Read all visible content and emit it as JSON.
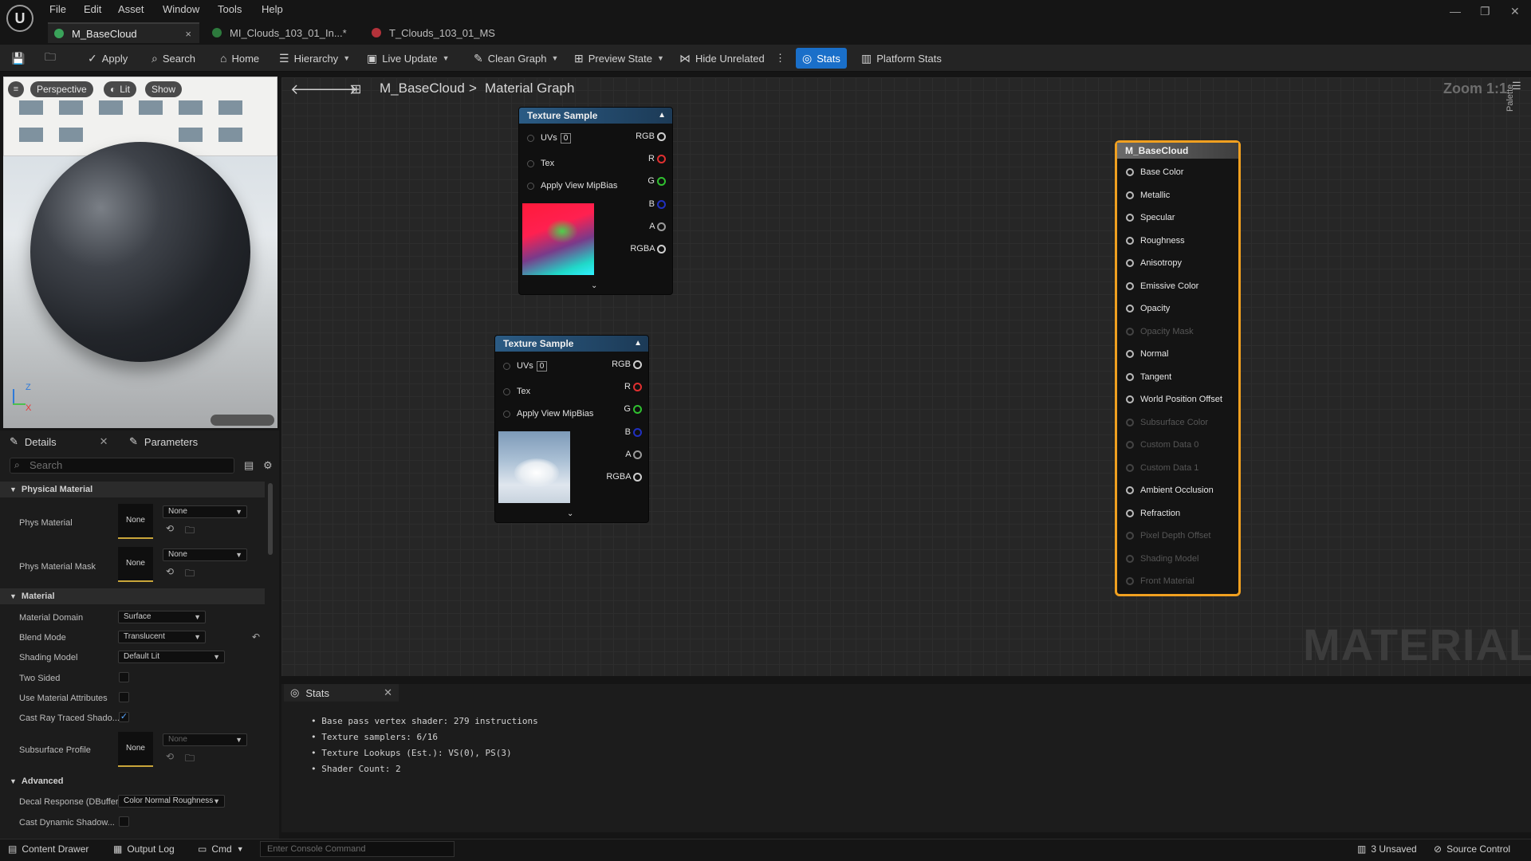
{
  "menu": [
    "File",
    "Edit",
    "Asset",
    "Window",
    "Tools",
    "Help"
  ],
  "tabs": [
    {
      "label": "M_BaseCloud",
      "close": "×"
    },
    {
      "label": "MI_Clouds_103_01_In...*"
    },
    {
      "label": "T_Clouds_103_01_MS"
    }
  ],
  "toolbar": {
    "apply": "Apply",
    "search": "Search",
    "home": "Home",
    "hierarchy": "Hierarchy",
    "live_update": "Live Update",
    "clean_graph": "Clean Graph",
    "preview_state": "Preview State",
    "hide_unrelated": "Hide Unrelated",
    "stats": "Stats",
    "platform_stats": "Platform Stats"
  },
  "viewport": {
    "perspective": "Perspective",
    "lit": "Lit",
    "show": "Show",
    "axis_z": "Z",
    "axis_x": "X"
  },
  "panel": {
    "details": "Details",
    "parameters": "Parameters",
    "search_placeholder": "Search"
  },
  "physical_material": {
    "section": "Physical Material",
    "phys_material": "Phys Material",
    "phys_material_mask": "Phys Material Mask",
    "none": "None"
  },
  "material": {
    "section": "Material",
    "domain_label": "Material Domain",
    "domain_value": "Surface",
    "blend_label": "Blend Mode",
    "blend_value": "Translucent",
    "shading_label": "Shading Model",
    "shading_value": "Default Lit",
    "two_sided": "Two Sided",
    "use_attrs": "Use Material Attributes",
    "cast_ray": "Cast Ray Traced Shado...",
    "subsurface": "Subsurface Profile"
  },
  "advanced": {
    "section": "Advanced",
    "decal_label": "Decal Response (DBuffer)",
    "decal_value": "Color Normal Roughness",
    "cast_dynamic": "Cast Dynamic Shadow..."
  },
  "graph": {
    "asset": "M_BaseCloud",
    "sep": ">",
    "title": "Material Graph",
    "zoom": "Zoom 1:1",
    "watermark": "MATERIAL",
    "palette": "Palette"
  },
  "texture_nodes": [
    {
      "title": "Texture Sample",
      "uvs": "UVs",
      "uv_index": "0",
      "tex": "Tex",
      "mip": "Apply View MipBias",
      "outputs": [
        "RGB",
        "R",
        "G",
        "B",
        "A",
        "RGBA"
      ]
    },
    {
      "title": "Texture Sample",
      "uvs": "UVs",
      "uv_index": "0",
      "tex": "Tex",
      "mip": "Apply View MipBias",
      "outputs": [
        "RGB",
        "R",
        "G",
        "B",
        "A",
        "RGBA"
      ]
    }
  ],
  "material_node": {
    "title": "M_BaseCloud",
    "inputs": [
      {
        "label": "Base Color",
        "enabled": true
      },
      {
        "label": "Metallic",
        "enabled": true
      },
      {
        "label": "Specular",
        "enabled": true
      },
      {
        "label": "Roughness",
        "enabled": true
      },
      {
        "label": "Anisotropy",
        "enabled": true
      },
      {
        "label": "Emissive Color",
        "enabled": true
      },
      {
        "label": "Opacity",
        "enabled": true
      },
      {
        "label": "Opacity Mask",
        "enabled": false
      },
      {
        "label": "Normal",
        "enabled": true
      },
      {
        "label": "Tangent",
        "enabled": true
      },
      {
        "label": "World Position Offset",
        "enabled": true
      },
      {
        "label": "Subsurface Color",
        "enabled": false
      },
      {
        "label": "Custom Data 0",
        "enabled": false
      },
      {
        "label": "Custom Data 1",
        "enabled": false
      },
      {
        "label": "Ambient Occlusion",
        "enabled": true
      },
      {
        "label": "Refraction",
        "enabled": true
      },
      {
        "label": "Pixel Depth Offset",
        "enabled": false
      },
      {
        "label": "Shading Model",
        "enabled": false
      },
      {
        "label": "Front Material",
        "enabled": false
      }
    ]
  },
  "stats": {
    "tab": "Stats",
    "lines": [
      "Base pass vertex shader: 279 instructions",
      "Texture samplers: 6/16",
      "Texture Lookups (Est.): VS(0), PS(3)",
      "Shader Count: 2"
    ]
  },
  "statusbar": {
    "content_drawer": "Content Drawer",
    "output_log": "Output Log",
    "cmd": "Cmd",
    "console_placeholder": "Enter Console Command",
    "unsaved": "3 Unsaved",
    "source_control": "Source Control"
  },
  "colors": {
    "accent": "#1a6fc9",
    "node_header": "#2b5b84",
    "material_border": "#f0a020"
  }
}
